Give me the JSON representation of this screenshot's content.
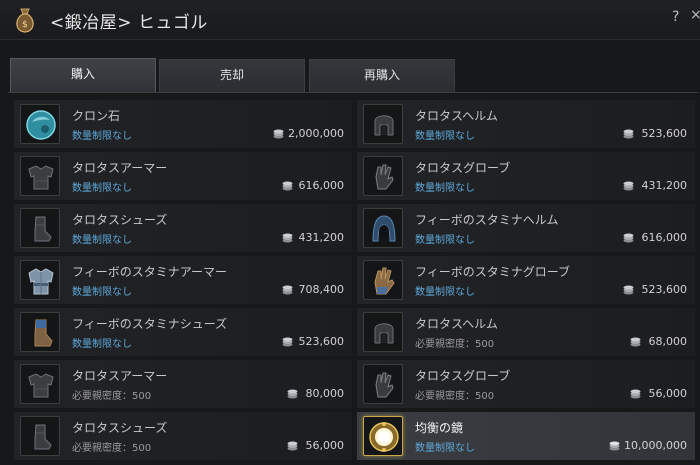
{
  "window": {
    "title": "<鍛冶屋> ヒュゴル",
    "help_label": "?",
    "close_label": "×",
    "bag_icon": "money-bag-icon"
  },
  "tabs": [
    {
      "label": "購入",
      "active": true
    },
    {
      "label": "売却",
      "active": false
    },
    {
      "label": "再購入",
      "active": false
    }
  ],
  "items": [
    {
      "name": "クロン石",
      "limit": "数量制限なし",
      "price": "2,000,000",
      "icon": "cron-stone-icon"
    },
    {
      "name": "タロタスヘルム",
      "limit": "数量制限なし",
      "price": "523,600",
      "icon": "helmet-icon"
    },
    {
      "name": "タロタスアーマー",
      "limit": "数量制限なし",
      "price": "616,000",
      "icon": "armor-icon"
    },
    {
      "name": "タロタスグローブ",
      "limit": "数量制限なし",
      "price": "431,200",
      "icon": "gloves-icon"
    },
    {
      "name": "タロタスシューズ",
      "limit": "数量制限なし",
      "price": "431,200",
      "icon": "shoes-icon"
    },
    {
      "name": "フィーボのスタミナヘルム",
      "limit": "数量制限なし",
      "price": "616,000",
      "icon": "hood-icon"
    },
    {
      "name": "フィーボのスタミナアーマー",
      "limit": "数量制限なし",
      "price": "708,400",
      "icon": "tunic-icon"
    },
    {
      "name": "フィーボのスタミナグローブ",
      "limit": "数量制限なし",
      "price": "523,600",
      "icon": "blue-gloves-icon"
    },
    {
      "name": "フィーボのスタミナシューズ",
      "limit": "数量制限なし",
      "price": "523,600",
      "icon": "blue-shoes-icon"
    },
    {
      "name": "タロタスヘルム",
      "limit": "必要親密度：500",
      "price": "68,000",
      "icon": "helmet-icon"
    },
    {
      "name": "タロタスアーマー",
      "limit": "必要親密度：500",
      "price": "80,000",
      "icon": "armor-icon"
    },
    {
      "name": "タロタスグローブ",
      "limit": "必要親密度：500",
      "price": "56,000",
      "icon": "gloves-icon"
    },
    {
      "name": "タロタスシューズ",
      "limit": "必要親密度：500",
      "price": "56,000",
      "icon": "shoes-icon"
    },
    {
      "name": "均衡の鏡",
      "limit": "数量制限なし",
      "price": "10,000,000",
      "icon": "mirror-icon",
      "selected": true
    }
  ],
  "currency_icon": "silver-coin-icon",
  "colors": {
    "limit_text": "#5fa8d8",
    "selected_border": "#c9a847"
  }
}
